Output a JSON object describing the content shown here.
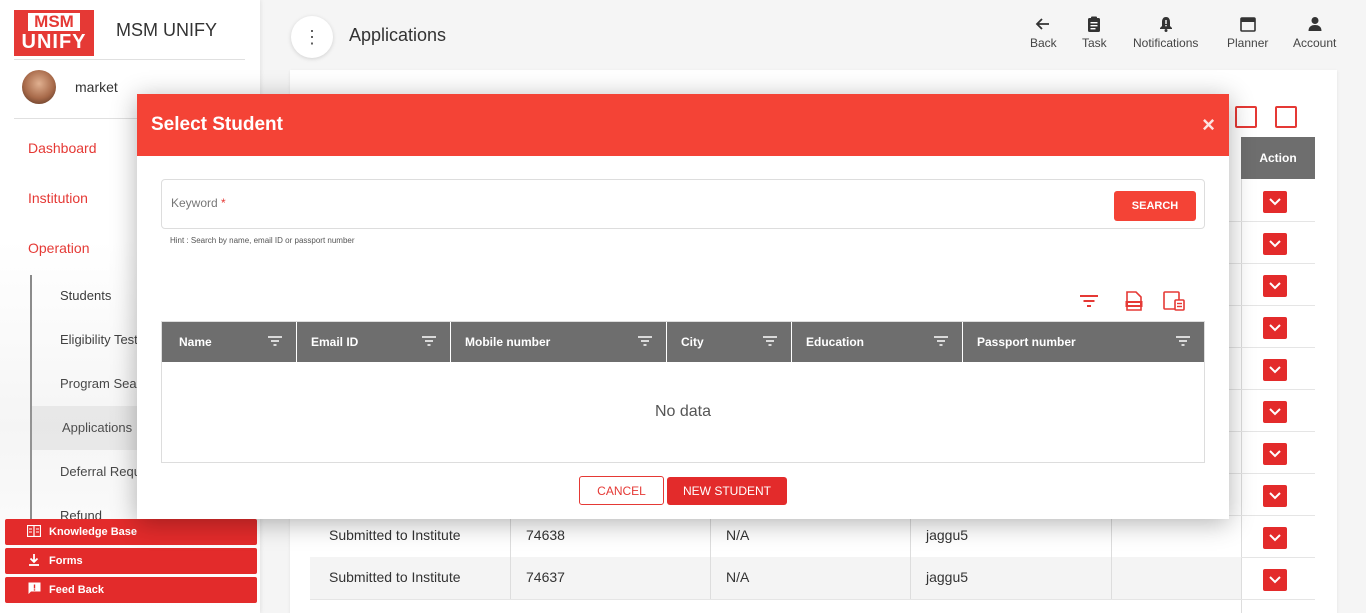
{
  "brand": {
    "logo_top": "MSM",
    "logo_bottom": "UNIFY",
    "name": "MSM UNIFY"
  },
  "user": {
    "name": "market"
  },
  "nav": {
    "items": [
      {
        "label": "Dashboard"
      },
      {
        "label": "Institution"
      },
      {
        "label": "Operation"
      }
    ],
    "sub_items": [
      {
        "label": "Students"
      },
      {
        "label": "Eligibility Test"
      },
      {
        "label": "Program Sear"
      },
      {
        "label": "Applications"
      },
      {
        "label": "Deferral Requ"
      },
      {
        "label": "Refund"
      }
    ]
  },
  "quick_links": [
    {
      "label": "Knowledge Base",
      "icon": "book-icon"
    },
    {
      "label": "Forms",
      "icon": "download-icon"
    },
    {
      "label": "Feed Back",
      "icon": "feedback-icon"
    }
  ],
  "header": {
    "title": "Applications",
    "actions": [
      {
        "label": "Back",
        "icon": "arrow-left-icon"
      },
      {
        "label": "Task",
        "icon": "clipboard-icon"
      },
      {
        "label": "Notifications",
        "icon": "bell-icon"
      },
      {
        "label": "Planner",
        "icon": "calendar-icon"
      },
      {
        "label": "Account",
        "icon": "person-icon"
      }
    ]
  },
  "background_table": {
    "action_header": "Action",
    "rows": [
      {
        "status": "Submitted to Institute",
        "id": "74638",
        "value": "N/A",
        "user": "jaggu5"
      },
      {
        "status": "Submitted to Institute",
        "id": "74637",
        "value": "N/A",
        "user": "jaggu5"
      }
    ]
  },
  "modal": {
    "title": "Select Student",
    "close_glyph": "×",
    "search": {
      "label": "Keyword",
      "required_mark": "*",
      "value": "",
      "button": "SEARCH",
      "hint": "Hint : Search by name, email ID or passport number"
    },
    "table": {
      "columns": [
        "Name",
        "Email ID",
        "Mobile number",
        "City",
        "Education",
        "Passport number"
      ],
      "empty_text": "No data"
    },
    "buttons": {
      "cancel": "CANCEL",
      "new_student": "NEW STUDENT"
    }
  },
  "colors": {
    "accent": "#f44336",
    "button": "#e32b2b",
    "header_gray": "#6e6e6e"
  }
}
